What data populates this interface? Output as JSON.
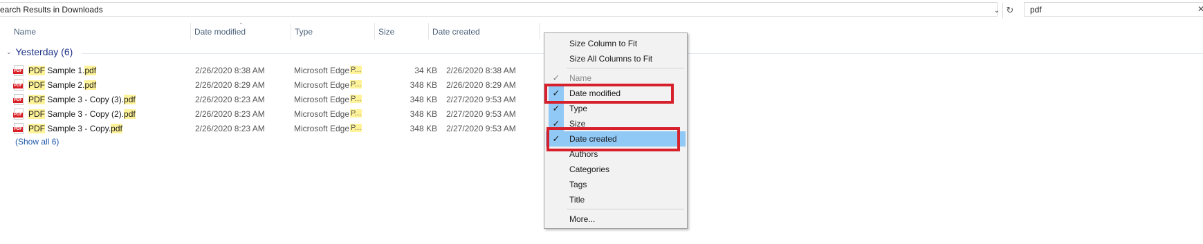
{
  "address_bar": {
    "text": "earch Results in Downloads",
    "dropdown_icon": "chevron-down-icon",
    "refresh_icon": "refresh-icon"
  },
  "search": {
    "value": "pdf",
    "clear_icon": "close-icon"
  },
  "columns": {
    "name": "Name",
    "date_modified": "Date modified",
    "type": "Type",
    "size": "Size",
    "date_created": "Date created"
  },
  "group": {
    "label": "Yesterday (6)"
  },
  "files": [
    {
      "prefix": "PDF",
      "mid": " Sample 1.",
      "ext": "pdf",
      "date_modified": "2/26/2020 8:38 AM",
      "type": "Microsoft Edge",
      "type_hl": "P...",
      "size": "34 KB",
      "date_created": "2/26/2020 8:38 AM"
    },
    {
      "prefix": "PDF",
      "mid": " Sample 2.",
      "ext": "pdf",
      "date_modified": "2/26/2020 8:29 AM",
      "type": "Microsoft Edge",
      "type_hl": "P...",
      "size": "348 KB",
      "date_created": "2/26/2020 8:29 AM"
    },
    {
      "prefix": "PDF",
      "mid": " Sample 3 - Copy (3).",
      "ext": "pdf",
      "date_modified": "2/26/2020 8:23 AM",
      "type": "Microsoft Edge",
      "type_hl": "P...",
      "size": "348 KB",
      "date_created": "2/27/2020 9:53 AM"
    },
    {
      "prefix": "PDF",
      "mid": " Sample 3 - Copy (2).",
      "ext": "pdf",
      "date_modified": "2/26/2020 8:23 AM",
      "type": "Microsoft Edge",
      "type_hl": "P...",
      "size": "348 KB",
      "date_created": "2/27/2020 9:53 AM"
    },
    {
      "prefix": "PDF",
      "mid": " Sample 3 - Copy.",
      "ext": "pdf",
      "date_modified": "2/26/2020 8:23 AM",
      "type": "Microsoft Edge",
      "type_hl": "P...",
      "size": "348 KB",
      "date_created": "2/27/2020 9:53 AM"
    }
  ],
  "show_all": "(Show all 6)",
  "context_menu": {
    "items": [
      {
        "label": "Size Column to Fit",
        "checked": false
      },
      {
        "label": "Size All Columns to Fit",
        "checked": false
      },
      {
        "label": "Name",
        "checked": true,
        "disabled": true
      },
      {
        "label": "Date modified",
        "checked": true
      },
      {
        "label": "Type",
        "checked": true
      },
      {
        "label": "Size",
        "checked": true
      },
      {
        "label": "Date created",
        "checked": true,
        "selected": true
      },
      {
        "label": "Authors",
        "checked": false
      },
      {
        "label": "Categories",
        "checked": false
      },
      {
        "label": "Tags",
        "checked": false
      },
      {
        "label": "Title",
        "checked": false
      },
      {
        "label": "More...",
        "checked": false
      }
    ],
    "check_glyph": "✓"
  },
  "colors": {
    "annotation_red": "#d6202c",
    "menu_highlight": "#90c8f6",
    "search_highlight": "#fff39a",
    "group_text": "#1e3287"
  }
}
